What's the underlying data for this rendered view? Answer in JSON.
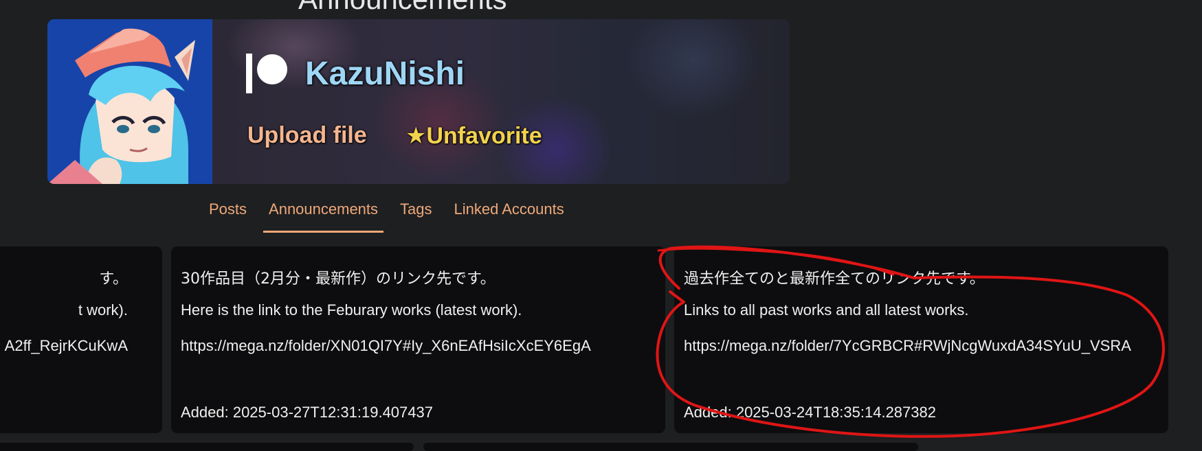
{
  "page": {
    "heading": "Announcements"
  },
  "creator": {
    "name": "KazuNishi",
    "upload_label": "Upload file",
    "favorite_label": "★Unfavorite",
    "name_color": "#9fd6f5",
    "upload_color": "#f4b58f",
    "favorite_color": "#f1d24c"
  },
  "tabs": [
    {
      "label": "Posts",
      "active": false
    },
    {
      "label": "Announcements",
      "active": true
    },
    {
      "label": "Tags",
      "active": false
    },
    {
      "label": "Linked Accounts",
      "active": false
    }
  ],
  "announcements": [
    {
      "title": "す。",
      "text": "t work).",
      "link": "A2ff_RejrKCuKwA"
    },
    {
      "title": "30作品目（2月分・最新作）のリンク先です。",
      "text": "Here is the link to the Feburary works (latest work).",
      "link": "https://mega.nz/folder/XN01QI7Y#Iy_X6nEAfHsiIcXcEY6EgA",
      "added": "Added: 2025-03-27T12:31:19.407437"
    },
    {
      "title": "過去作全てのと最新作全てのリンク先です。",
      "text": "Links to all past works and all latest works.",
      "link": "https://mega.nz/folder/7YcGRBCR#RWjNcgWuxdA34SYuU_VSRA",
      "added": "Added: 2025-03-24T18:35:14.287382"
    }
  ],
  "colors": {
    "accent": "#f0a878",
    "card_bg": "#0d0d0f",
    "page_bg": "#1d1f21",
    "annotation": "#e01515"
  },
  "icons": [
    "patreon-icon"
  ]
}
